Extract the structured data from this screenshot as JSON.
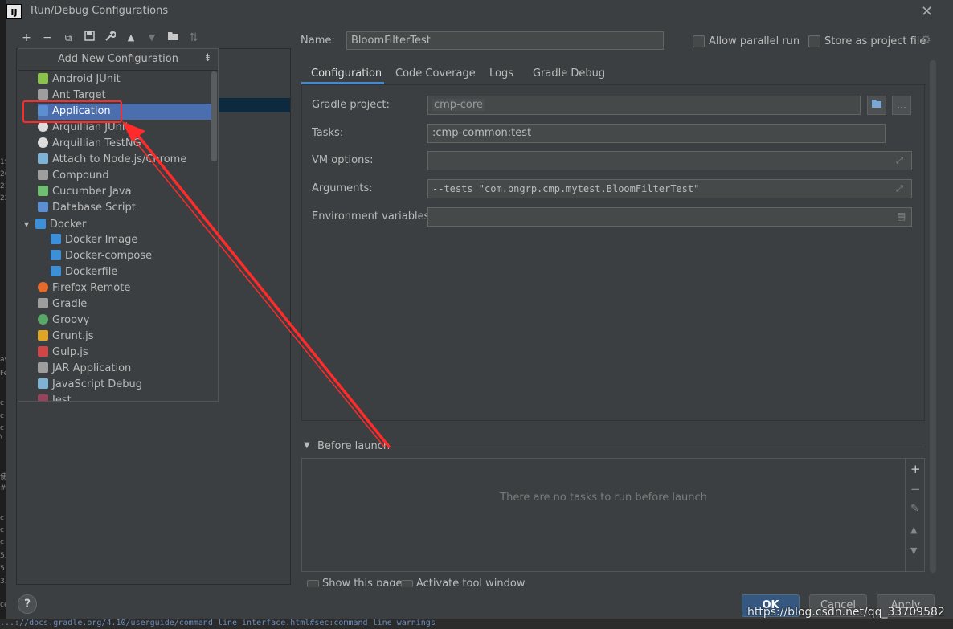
{
  "window": {
    "title": "Run/Debug Configurations",
    "logo": "IJ",
    "close": "✕"
  },
  "left_edge": [
    "19",
    "20",
    "21",
    "22",
    "as",
    "Fe",
    "c",
    "c",
    "c",
    "\\",
    "使",
    "#",
    "c",
    "c",
    "c",
    "5.",
    "5.",
    "3.",
    "ce"
  ],
  "toolbar": {
    "add": "+",
    "remove": "−",
    "copy": "⧉",
    "save": "💾",
    "edit": "🔧",
    "up": "▲",
    "down": "▼",
    "folder": "📁",
    "sort": "⇅"
  },
  "popup": {
    "header": "Add New Configuration",
    "collapse": "⇟",
    "items": [
      {
        "label": "Android JUnit",
        "icon": "android-icon",
        "color": "#8bc34a"
      },
      {
        "label": "Ant Target",
        "icon": "ant-icon",
        "color": "#9e9e9e"
      },
      {
        "label": "Application",
        "icon": "application-icon",
        "color": "#5b8fd1"
      },
      {
        "label": "Arquillian JUnit",
        "icon": "arquillian-icon",
        "color": "#dddddd"
      },
      {
        "label": "Arquillian TestNG",
        "icon": "arquillian-icon",
        "color": "#dddddd"
      },
      {
        "label": "Attach to Node.js/Chrome",
        "icon": "nodejs-icon",
        "color": "#7fb3d5"
      },
      {
        "label": "Compound",
        "icon": "compound-icon",
        "color": "#9e9e9e"
      },
      {
        "label": "Cucumber Java",
        "icon": "cucumber-icon",
        "color": "#6fbf73"
      },
      {
        "label": "Database Script",
        "icon": "database-icon",
        "color": "#5b8fd1"
      },
      {
        "label": "Docker",
        "icon": "docker-icon",
        "color": "#3d8fd8"
      },
      {
        "label": "Docker Image",
        "icon": "docker-icon",
        "color": "#3d8fd8"
      },
      {
        "label": "Docker-compose",
        "icon": "docker-icon",
        "color": "#3d8fd8"
      },
      {
        "label": "Dockerfile",
        "icon": "docker-icon",
        "color": "#3d8fd8"
      },
      {
        "label": "Firefox Remote",
        "icon": "firefox-icon",
        "color": "#e66a2c"
      },
      {
        "label": "Gradle",
        "icon": "gradle-icon",
        "color": "#9e9e9e"
      },
      {
        "label": "Groovy",
        "icon": "groovy-icon",
        "color": "#59a869"
      },
      {
        "label": "Grunt.js",
        "icon": "grunt-icon",
        "color": "#e0a526"
      },
      {
        "label": "Gulp.js",
        "icon": "gulp-icon",
        "color": "#cf4646"
      },
      {
        "label": "JAR Application",
        "icon": "jar-icon",
        "color": "#9e9e9e"
      },
      {
        "label": "JavaScript Debug",
        "icon": "js-debug-icon",
        "color": "#7fb3d5"
      },
      {
        "label": "Jest",
        "icon": "jest-icon",
        "color": "#99425b"
      }
    ]
  },
  "form": {
    "name_label": "Name:",
    "name_value": "BloomFilterTest",
    "allow_parallel": "Allow parallel run",
    "store_project": "Store as project file",
    "tabs": [
      "Configuration",
      "Code Coverage",
      "Logs",
      "Gradle Debug"
    ],
    "gradle_project_label": "Gradle project:",
    "gradle_project_value": "cmp-core",
    "browse": "…",
    "tasks_label": "Tasks:",
    "tasks_value": ":cmp-common:test",
    "vm_label": "VM options:",
    "vm_value": "",
    "args_label": "Arguments:",
    "args_value": "--tests \"com.bngrp.cmp.mytest.BloomFilterTest\"",
    "env_label": "Environment variables:",
    "env_value": ""
  },
  "before_launch": {
    "title": "Before launch",
    "empty": "There are no tasks to run before launch",
    "show_page": "Show this page",
    "activate_window": "Activate tool window"
  },
  "buttons": {
    "ok": "OK",
    "cancel": "Cancel",
    "apply": "Apply",
    "help": "?"
  },
  "status_text": "...://docs.gradle.org/4.10/userguide/command_line_interface.html#sec:command_line_warnings",
  "watermark": "https://blog.csdn.net/qq_33709582",
  "colors": {
    "highlight": "#ff2a2a",
    "accent": "#4a88c7",
    "selection": "#4b6eaf"
  }
}
